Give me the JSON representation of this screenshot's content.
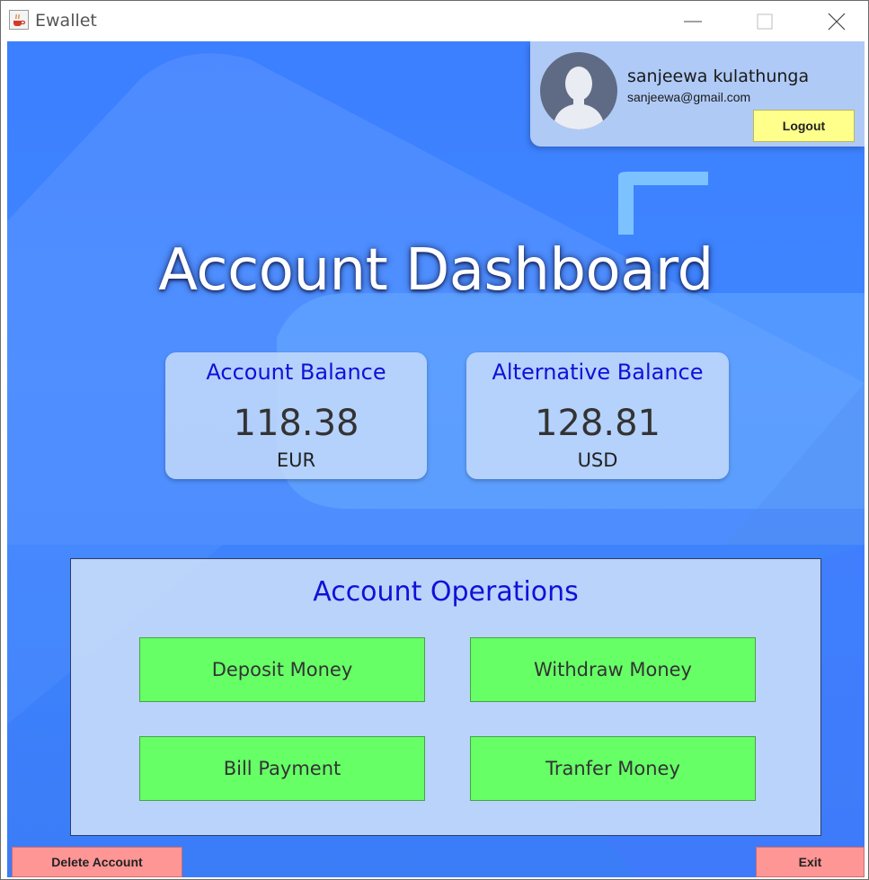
{
  "window": {
    "title": "Ewallet"
  },
  "profile": {
    "name": "sanjeewa kulathunga",
    "email": "sanjeewa@gmail.com",
    "logout_label": "Logout"
  },
  "dashboard": {
    "title": "Account Dashboard"
  },
  "balances": [
    {
      "label": "Account Balance",
      "value": "118.38",
      "currency": "EUR"
    },
    {
      "label": "Alternative Balance",
      "value": "128.81",
      "currency": "USD"
    }
  ],
  "operations": {
    "title": "Account Operations",
    "buttons": [
      "Deposit Money",
      "Withdraw Money",
      "Bill Payment",
      "Tranfer Money"
    ]
  },
  "footer": {
    "delete_label": "Delete Account",
    "exit_label": "Exit"
  },
  "colors": {
    "background": "#3f86ff",
    "operation_button": "#66ff66",
    "logout_button": "#ffff8c",
    "danger_button": "#ff9696",
    "heading_blue": "#1010d8"
  },
  "icons": {
    "app": "java-cup-icon",
    "minimize": "minimize-icon",
    "maximize": "maximize-icon",
    "close": "close-icon",
    "avatar": "user-silhouette-icon"
  }
}
